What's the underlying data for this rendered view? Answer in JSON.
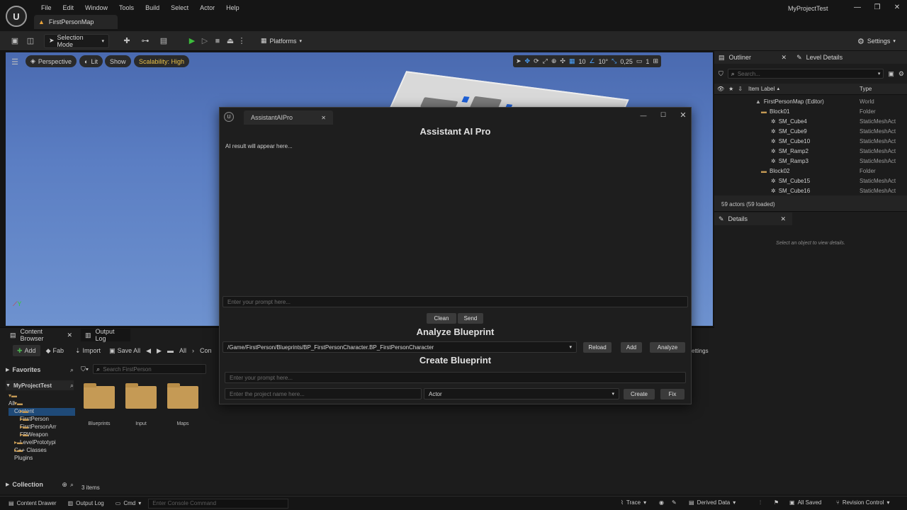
{
  "menu": [
    "File",
    "Edit",
    "Window",
    "Tools",
    "Build",
    "Select",
    "Actor",
    "Help"
  ],
  "map_tab": "FirstPersonMap",
  "project_name": "MyProjectTest",
  "toolbar": {
    "selection_mode": "Selection Mode",
    "platforms": "Platforms",
    "settings": "Settings"
  },
  "viewport": {
    "perspective": "Perspective",
    "lit": "Lit",
    "show": "Show",
    "scalability": "Scalability: High",
    "grid_value": "10",
    "angle_value": "10°",
    "scale_value": "0,25",
    "camera_value": "1"
  },
  "outliner": {
    "tab": "Outliner",
    "level_details_tab": "Level Details",
    "search_placeholder": "Search...",
    "col_label": "Item Label",
    "col_type": "Type",
    "rows": [
      {
        "label": "FirstPersonMap (Editor)",
        "type": "World"
      },
      {
        "label": "Block01",
        "type": "Folder"
      },
      {
        "label": "SM_Cube4",
        "type": "StaticMeshAct"
      },
      {
        "label": "SM_Cube9",
        "type": "StaticMeshAct"
      },
      {
        "label": "SM_Cube10",
        "type": "StaticMeshAct"
      },
      {
        "label": "SM_Ramp2",
        "type": "StaticMeshAct"
      },
      {
        "label": "SM_Ramp3",
        "type": "StaticMeshAct"
      },
      {
        "label": "Block02",
        "type": "Folder"
      },
      {
        "label": "SM_Cube15",
        "type": "StaticMeshAct"
      },
      {
        "label": "SM_Cube16",
        "type": "StaticMeshAct"
      }
    ],
    "actors_count": "59 actors (59 loaded)"
  },
  "details": {
    "tab": "Details",
    "empty_text": "Select an object to view details."
  },
  "content_browser": {
    "tab": "Content Browser",
    "output_log_tab": "Output Log",
    "add": "Add",
    "fab": "Fab",
    "import": "Import",
    "save_all": "Save All",
    "path_all": "All",
    "path_content": "Con",
    "settings": "ettings",
    "favorites": "Favorites",
    "project": "MyProjectTest",
    "search_placeholder": "Search FirstPerson",
    "tree": [
      "All",
      "Content",
      "FirstPerson",
      "FirstPersonArr",
      "FPWeapon",
      "LevelPrototypi",
      "C++ Classes",
      "Plugins"
    ],
    "folders": [
      "Blueprints",
      "Input",
      "Maps"
    ],
    "collection": "Collection",
    "items_count": "3 items"
  },
  "bottombar": {
    "content_drawer": "Content Drawer",
    "output_log": "Output Log",
    "cmd": "Cmd",
    "console_placeholder": "Enter Console Command",
    "trace": "Trace",
    "derived_data": "Derived Data",
    "all_saved": "All Saved",
    "revision_control": "Revision Control"
  },
  "dialog": {
    "tab_title": "AssistantAIPro",
    "heading": "Assistant AI Pro",
    "result_text": "AI result will appear here...",
    "prompt_placeholder": "Enter your prompt here...",
    "clean": "Clean",
    "send": "Send",
    "analyze_heading": "Analyze Blueprint",
    "blueprint_path": "/Game/FirstPerson/Blueprints/BP_FirstPersonCharacter.BP_FirstPersonCharacter",
    "reload": "Reload",
    "add": "Add",
    "analyze": "Analyze",
    "create_heading": "Create Blueprint",
    "create_prompt_placeholder": "Enter your prompt here...",
    "project_name_placeholder": "Enter the project name here...",
    "class_value": "Actor",
    "create": "Create",
    "fix": "Fix"
  }
}
